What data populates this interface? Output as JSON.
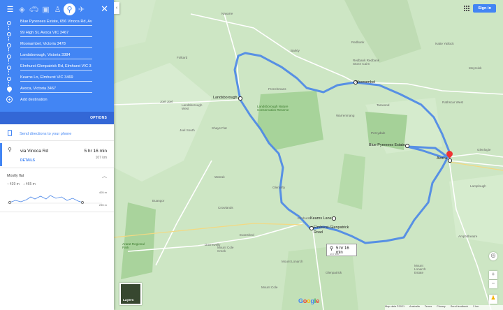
{
  "panel": {
    "modes": [
      "menu-icon",
      "directions-icon",
      "car-icon",
      "transit-icon",
      "walk-icon",
      "bicycle-icon",
      "flight-icon"
    ],
    "waypoints": [
      {
        "label": "Blue Pyrenees Estate, 656 Vinoca Rd, Av"
      },
      {
        "label": "99 High St, Avoca VIC 3467"
      },
      {
        "label": "Moonambel, Victoria 3478"
      },
      {
        "label": "Landsborough, Victoria 3384"
      },
      {
        "label": "Elmhurst-Glenpatrick Rd, Elmhurst VIC 3"
      },
      {
        "label": "Kearns Ln, Elmhurst VIC 3469"
      },
      {
        "label": "Avoca, Victoria 3467"
      }
    ],
    "add_destination": "Add destination",
    "options": "OPTIONS",
    "send_directions": "Send directions to your phone",
    "route": {
      "via": "via Vinoca Rd",
      "time": "5 hr 16 min",
      "distance": "107 km",
      "details": "DETAILS"
    },
    "elevation": {
      "summary": "Mostly flat",
      "up": "↑ 439 m",
      "down": "↓ 465 m",
      "high": "405 m",
      "low": "235 m"
    }
  },
  "map": {
    "signin": "Sign in",
    "layers": "Layers",
    "route_box": {
      "time": "5 hr 16 min",
      "distance": "107 km"
    },
    "waypoint_labels": {
      "moonambel": "Moonambel",
      "landsborough": "Landsborough",
      "blue_pyrenees": "Blue Pyrenees Estate",
      "avoca": "Avoca",
      "kearns": "Kearns Lane",
      "elmhurst": "Elmhurst-Glenpatrick Road"
    },
    "places": [
      {
        "name": "Navarre"
      },
      {
        "name": "Redbank"
      },
      {
        "name": "Redbank Redbank Stone Cairn"
      },
      {
        "name": "Natte Yallock"
      },
      {
        "name": "Barkly"
      },
      {
        "name": "Frenchmans"
      },
      {
        "name": "Tanwood"
      },
      {
        "name": "Rathscar West"
      },
      {
        "name": "Landsborough West"
      },
      {
        "name": "Moyreisk"
      },
      {
        "name": "Percydale"
      },
      {
        "name": "Glenlogie"
      },
      {
        "name": "Lamplough"
      },
      {
        "name": "Warrenmang"
      },
      {
        "name": "Joel Joel"
      },
      {
        "name": "Joel South"
      },
      {
        "name": "Shays Flat"
      },
      {
        "name": "Folkard"
      },
      {
        "name": "Glenlofty"
      },
      {
        "name": "Buangor"
      },
      {
        "name": "Crowlands"
      },
      {
        "name": "Warrak"
      },
      {
        "name": "Elmhurst"
      },
      {
        "name": "Amphitheatre"
      },
      {
        "name": "Ararat Regional Park"
      },
      {
        "name": "Mount Cole Creek"
      },
      {
        "name": "Mount Lonarch"
      },
      {
        "name": "Glenpatrick"
      },
      {
        "name": "Mount Cole"
      },
      {
        "name": "Evansford"
      },
      {
        "name": "Mount Lonarch Estate"
      },
      {
        "name": "Landsborough Nature Conservation Reserve"
      },
      {
        "name": "Ducrewelly"
      }
    ],
    "footer": [
      "Map data ©2021",
      "Australia",
      "Terms",
      "Privacy",
      "Send feedback",
      "2 km"
    ],
    "route_color": "#4a86e8",
    "map_bg": "#cde6c4"
  }
}
